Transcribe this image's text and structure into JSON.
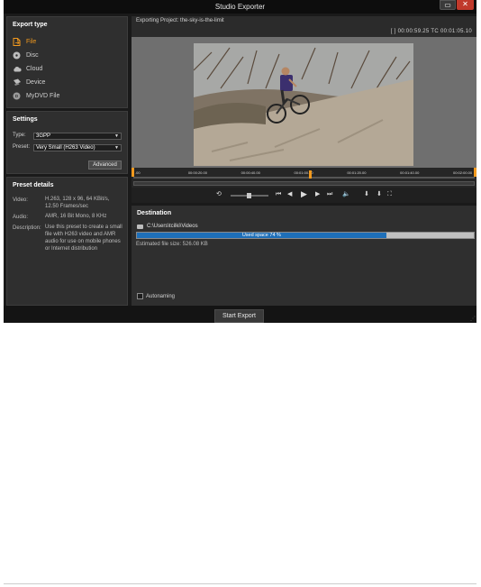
{
  "window": {
    "title": "Studio Exporter"
  },
  "export_type": {
    "heading": "Export type",
    "items": [
      {
        "label": "File",
        "icon": "file-icon",
        "active": true
      },
      {
        "label": "Disc",
        "icon": "disc-icon",
        "active": false
      },
      {
        "label": "Cloud",
        "icon": "cloud-icon",
        "active": false
      },
      {
        "label": "Device",
        "icon": "device-icon",
        "active": false
      },
      {
        "label": "MyDVD File",
        "icon": "mydvd-icon",
        "active": false
      }
    ]
  },
  "settings": {
    "heading": "Settings",
    "type_label": "Type:",
    "type_value": "3GPP",
    "preset_label": "Preset:",
    "preset_value": "Very Small (H263 Video)",
    "advanced_label": "Advanced"
  },
  "preset_details": {
    "heading": "Preset details",
    "video_label": "Video:",
    "video_value": "H.263, 128 x 96, 64 KBit/s, 12.50 Frames/sec",
    "audio_label": "Audio:",
    "audio_value": "AMR, 16 Bit Mono, 8 KHz",
    "description_label": "Description:",
    "description_value": "Use this preset to create a small file with H263 video and AMR audio for use on mobile phones or Internet distribution"
  },
  "preview": {
    "project_text": "Exporting Project: the-sky-is-the-limit",
    "timecode": "[ ] 00:00:59.25   TC 00:01:05.10"
  },
  "timeline": {
    "ticks": [
      ".00",
      "00:00:20.00",
      "00:00:40.00",
      "00:01:00.00",
      "00:01:20.00",
      "00:01:40.00",
      "00:02:00.00"
    ],
    "playhead_fraction": 0.52
  },
  "destination": {
    "heading": "Destination",
    "path": "C:\\Users\\tcilki\\Videos",
    "used_space_label": "Used space 74 %",
    "used_fraction": 0.74,
    "estimated_size": "Estimated file size: 526.08 KB",
    "autonaming_label": "Autonaming"
  },
  "start_export_label": "Start Export",
  "colors": {
    "accent": "#f39a1e",
    "progress": "#1e6fb8"
  }
}
